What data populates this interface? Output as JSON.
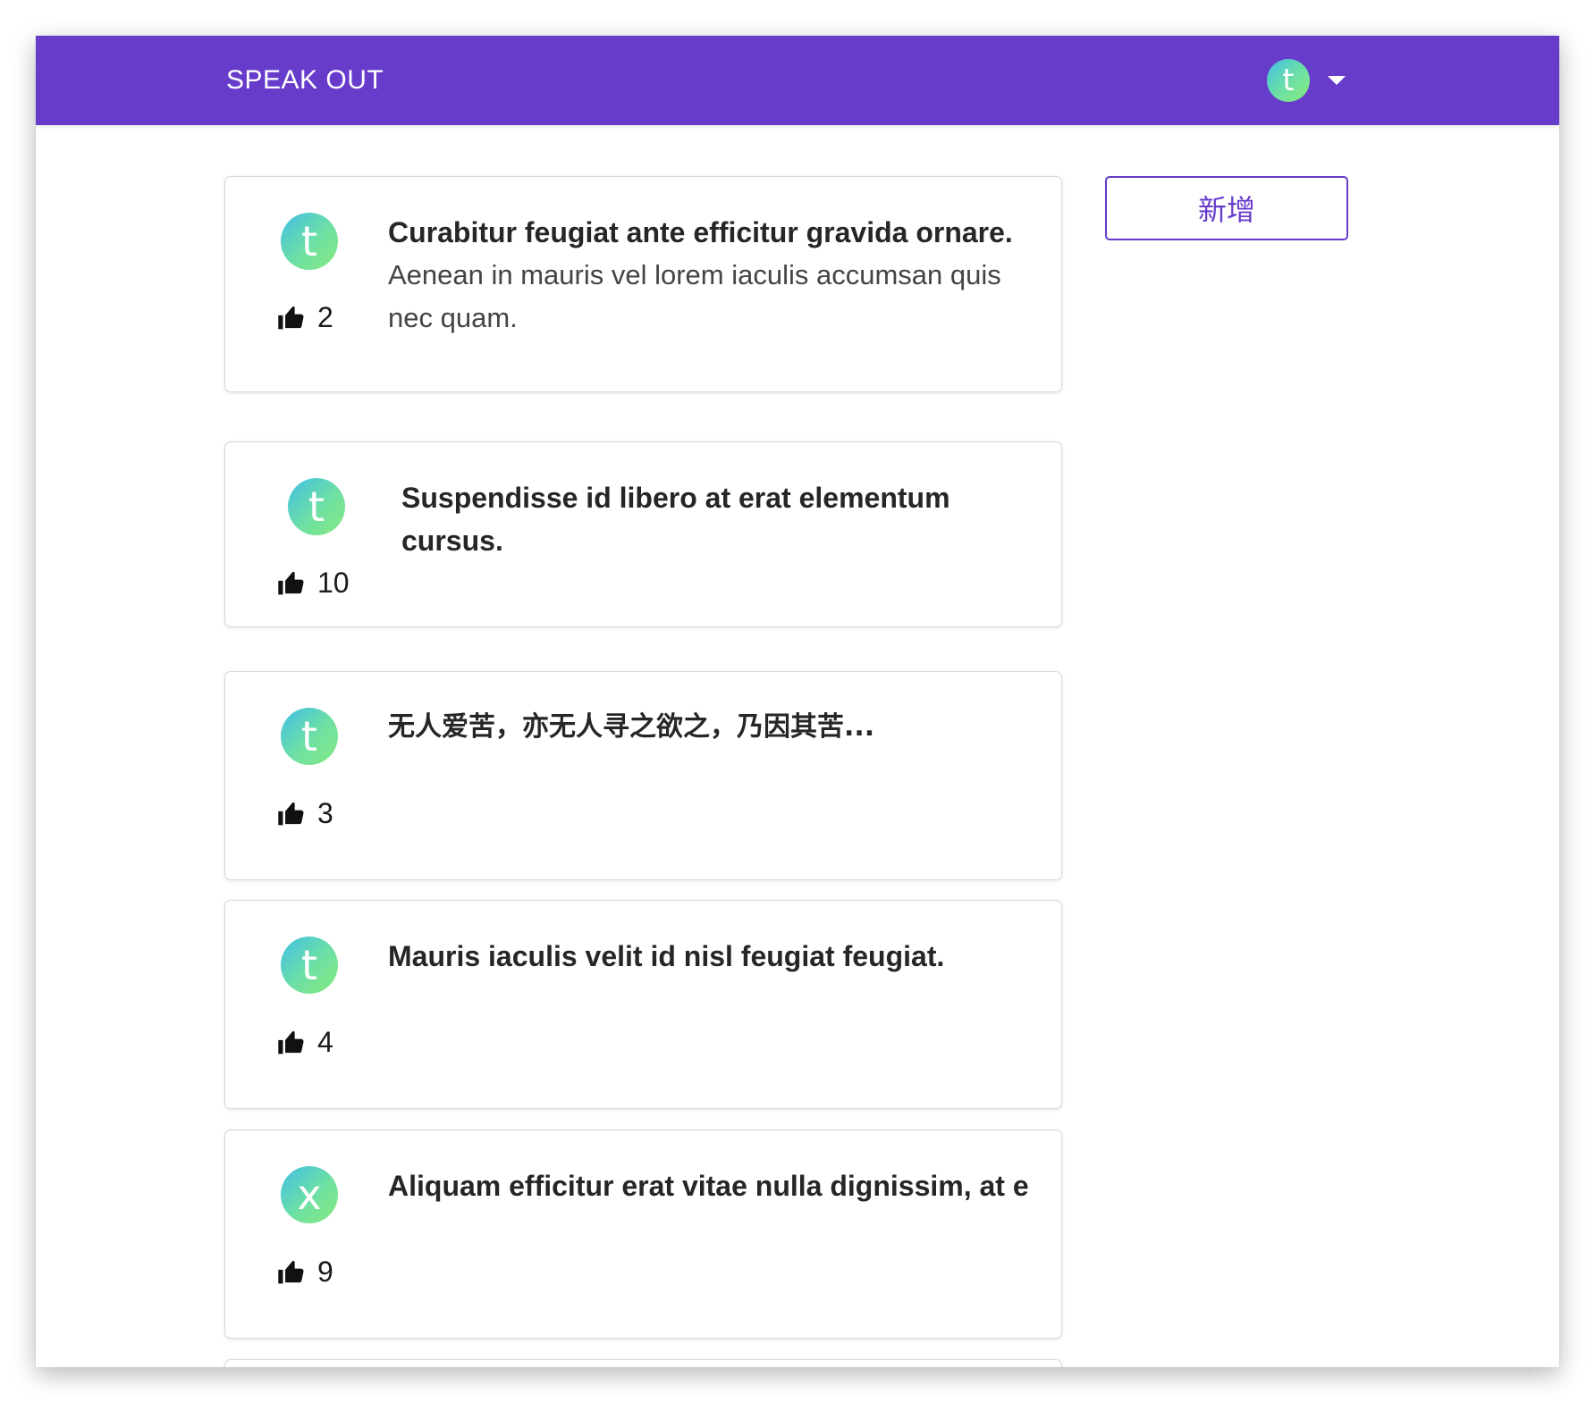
{
  "navbar": {
    "brand": "SPEAK OUT",
    "user_initial": "t",
    "background_color": "#673ccb"
  },
  "new_button_label": "新增",
  "posts": [
    {
      "avatar": "t",
      "likes": "2",
      "title": "Curabitur feugiat ante efficitur gravida ornare.",
      "body": "Aenean in mauris vel lorem iaculis accumsan quis nec quam."
    },
    {
      "avatar": "t",
      "likes": "10",
      "title": "Suspendisse id libero at erat elementum cursus.",
      "body": ""
    },
    {
      "avatar": "t",
      "likes": "3",
      "title": "无人爱苦，亦无人寻之欲之，乃因其苦...",
      "body": ""
    },
    {
      "avatar": "t",
      "likes": "4",
      "title": "Mauris iaculis velit id nisl feugiat feugiat.",
      "body": ""
    },
    {
      "avatar": "x",
      "likes": "9",
      "title": "Aliquam efficitur erat vitae nulla dignissim, at e",
      "body": ""
    }
  ],
  "icons": {
    "like": "thumbs-up-icon",
    "user_menu": "caret-down-icon"
  },
  "colors": {
    "accent": "#673ccb",
    "avatar_gradient_start": "#41bfe6",
    "avatar_gradient_end": "#86ea7e"
  }
}
